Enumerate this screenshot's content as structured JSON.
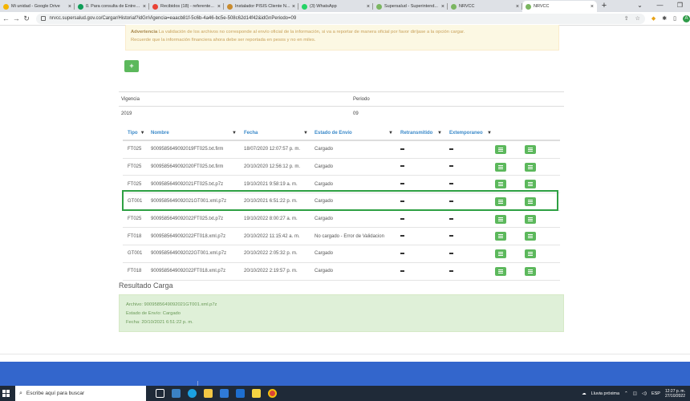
{
  "browser": {
    "tabs": [
      {
        "title": "Mi unidad - Google Drive",
        "color": "#f4b400",
        "active": false
      },
      {
        "title": "0. Para consulta de Entreg...",
        "color": "#0f9d58",
        "active": false
      },
      {
        "title": "Recibidos (18) - referente...",
        "color": "#ea4335",
        "active": false
      },
      {
        "title": "Instalador PISIS Cliente N...",
        "color": "#c98b2e",
        "active": false
      },
      {
        "title": "(3) WhatsApp",
        "color": "#25d366",
        "active": false
      },
      {
        "title": "Supersalud - Superintend...",
        "color": "#7bb661",
        "active": false
      },
      {
        "title": "NRVCC",
        "color": "#7bb661",
        "active": false
      },
      {
        "title": "NRVCC",
        "color": "#7bb661",
        "active": true
      }
    ],
    "new_tab": "+",
    "url": "nrvcc.supersalud.gov.co/Cargar/Historial?idGnVigencia=eaacb81f-5c6b-4a46-bc5e-508c62d14f42&idGnPeriodo=09",
    "profile_initial": "A"
  },
  "alert": {
    "strong": "Advertencia",
    "line1": " La validación de los archivos no corresponde al envío oficial de la información, si va a reportar de manera oficial por favor diríjase a la opción cargar.",
    "line2": "Recuerde que la información financiera ahora debe ser reportada en pesos y no en miles."
  },
  "add_button": "+",
  "vigencia": {
    "headers": {
      "vigencia": "Vigencia",
      "periodo": "Periodo"
    },
    "values": {
      "vigencia": "2019",
      "periodo": "09"
    }
  },
  "grid": {
    "headers": {
      "tipo": "Tipo",
      "nombre": "Nombre",
      "fecha": "Fecha",
      "estado": "Estado de Envío",
      "retransmitido": "Retransmitido",
      "extemporaneo": "Extemporaneo"
    },
    "rows": [
      {
        "tipo": "FT025",
        "nombre": "9009585649092019FT025.txt.firm",
        "fecha": "18/07/2020 12:07:57 p. m.",
        "estado": "Cargado"
      },
      {
        "tipo": "FT025",
        "nombre": "9009585649092020FT025.txt.firm",
        "fecha": "20/10/2020 12:56:12 p. m.",
        "estado": "Cargado"
      },
      {
        "tipo": "FT025",
        "nombre": "9009585649092021FT025.txt.p7z",
        "fecha": "19/10/2021 9:58:19 a. m.",
        "estado": "Cargado"
      },
      {
        "tipo": "GT001",
        "nombre": "9009585649092021GT001.xml.p7z",
        "fecha": "20/10/2021 6:51:22 p. m.",
        "estado": "Cargado"
      },
      {
        "tipo": "FT025",
        "nombre": "9009585649092022FT025.txt.p7z",
        "fecha": "19/10/2022 8:00:27 a. m.",
        "estado": "Cargado"
      },
      {
        "tipo": "FT018",
        "nombre": "9009585649092022FT018.xml.p7z",
        "fecha": "20/10/2022 11:15:42 a. m.",
        "estado": "No cargado - Error de Validacion"
      },
      {
        "tipo": "GT001",
        "nombre": "9009585649092022GT001.xml.p7z",
        "fecha": "20/10/2022 2:05:32 p. m.",
        "estado": "Cargado"
      },
      {
        "tipo": "FT018",
        "nombre": "9009585649092022FT018.xml.p7z",
        "fecha": "20/10/2022 2:19:57 p. m.",
        "estado": "Cargado"
      }
    ]
  },
  "resultado": {
    "title": "Resultado Carga",
    "archivo": "Archivo: 9009585649092021GT001.xml.p7z",
    "estado": "Estado de Envío: Cargado",
    "fecha": "Fecha: 20/10/2021 6:51:22 p. m."
  },
  "taskbar": {
    "search_placeholder": "Escribe aquí para buscar",
    "weather": "Lluvia próxima",
    "lang": "ESP",
    "time": "12:27 p. m.",
    "date": "27/10/2022"
  },
  "colors": {
    "accent": "#3a89c9",
    "success": "#5cb85c",
    "highlight": "#2ea043",
    "footer": "#3366cc"
  }
}
